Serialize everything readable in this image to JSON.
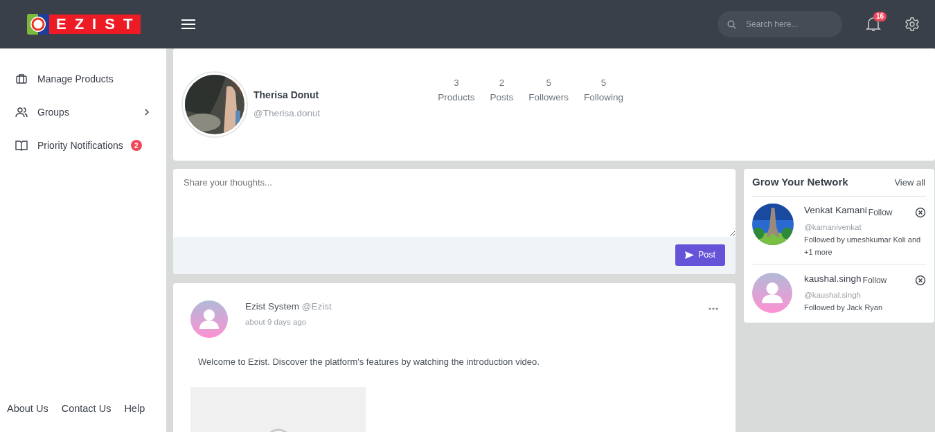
{
  "header": {
    "logo_text": "EZIST",
    "search": {
      "placeholder": "Search here..."
    },
    "notifications_count": "16"
  },
  "sidebar": {
    "items": [
      {
        "kind": "products",
        "label": "Manage Products",
        "has_submenu": false
      },
      {
        "kind": "groups",
        "label": "Groups",
        "has_submenu": true
      },
      {
        "kind": "notifications",
        "label": "Priority Notifications",
        "has_submenu": false,
        "badge": "2"
      }
    ],
    "footer_links": [
      "About Us",
      "Contact Us",
      "Help"
    ]
  },
  "profile": {
    "name": "Therisa Donut",
    "handle": "@Therisa.donut",
    "stats": [
      {
        "value": "3",
        "label": "Products"
      },
      {
        "value": "2",
        "label": "Posts"
      },
      {
        "value": "5",
        "label": "Followers"
      },
      {
        "value": "5",
        "label": "Following"
      }
    ]
  },
  "composer": {
    "placeholder": "Share your thoughts...",
    "button": "Post"
  },
  "post": {
    "author": "Ezist System",
    "handle": "@Ezist",
    "time": "about 9 days ago",
    "text": "Welcome to Ezist. Discover the platform's features by watching the introduction video."
  },
  "network": {
    "title": "Grow Your Network",
    "view_all": "View all",
    "people": [
      {
        "name": "Venkat Kamani",
        "handle": "@kamanivenkat",
        "followed_by": "Followed by umeshkumar Koli and +1 more",
        "action": "Follow"
      },
      {
        "name": "kaushal.singh",
        "handle": "@kaushal.singh",
        "followed_by": "Followed by Jack Ryan",
        "avatar": {
          "kind": "default"
        },
        "action": "Follow"
      }
    ]
  }
}
